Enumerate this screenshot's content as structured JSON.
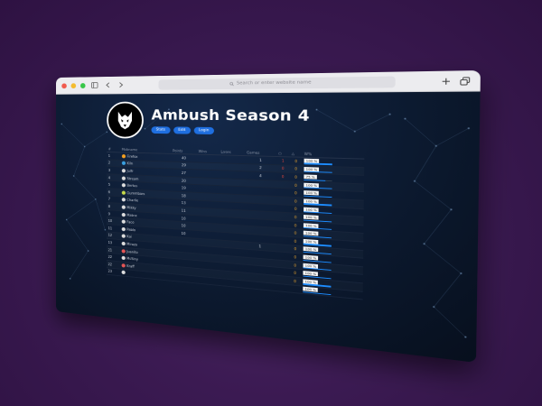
{
  "browser": {
    "address_placeholder": "Search or enter website name"
  },
  "page": {
    "title": "Ambush Season 4",
    "buttons": [
      "Stats",
      "Edit",
      "Login"
    ]
  },
  "table": {
    "headers": [
      "#",
      "Mobname",
      "Points",
      "Wins",
      "Loses",
      "Games",
      "○",
      "△",
      "W%"
    ],
    "rows": [
      {
        "rank": "1",
        "name": "Firefox",
        "points": "40",
        "wins": "",
        "loses": "",
        "games": "1",
        "c1": "1",
        "c2": "0",
        "pct": "100 %",
        "ratio": 1.0,
        "av": "#f5a020"
      },
      {
        "rank": "2",
        "name": "Kiln",
        "points": "29",
        "wins": "",
        "loses": "",
        "games": "2",
        "c1": "0",
        "c2": "0",
        "pct": "100 %",
        "ratio": 1.0,
        "av": "#3aa0e0"
      },
      {
        "rank": "3",
        "name": "Julfr",
        "points": "27",
        "wins": "",
        "loses": "",
        "games": "4",
        "c1": "0",
        "c2": "0",
        "pct": "75 %",
        "ratio": 0.75,
        "av": "#dddddd"
      },
      {
        "rank": "4",
        "name": "Stream",
        "points": "20",
        "wins": "",
        "loses": "",
        "games": "",
        "c1": "",
        "c2": "0",
        "pct": "100 %",
        "ratio": 1.0,
        "av": "#dddddd"
      },
      {
        "rank": "5",
        "name": "Bertus",
        "points": "19",
        "wins": "",
        "loses": "",
        "games": "",
        "c1": "",
        "c2": "0",
        "pct": "100 %",
        "ratio": 1.0,
        "av": "#dddddd"
      },
      {
        "rank": "6",
        "name": "Gummbars",
        "points": "18",
        "wins": "",
        "loses": "",
        "games": "",
        "c1": "",
        "c2": "0",
        "pct": "100 %",
        "ratio": 1.0,
        "av": "#c7d94a"
      },
      {
        "rank": "7",
        "name": "Charlie",
        "points": "13",
        "wins": "",
        "loses": "",
        "games": "",
        "c1": "",
        "c2": "0",
        "pct": "100 %",
        "ratio": 1.0,
        "av": "#dddddd"
      },
      {
        "rank": "8",
        "name": "Mikky",
        "points": "11",
        "wins": "",
        "loses": "",
        "games": "",
        "c1": "",
        "c2": "0",
        "pct": "100 %",
        "ratio": 1.0,
        "av": "#dddddd"
      },
      {
        "rank": "9",
        "name": "Matrıx",
        "points": "10",
        "wins": "",
        "loses": "",
        "games": "",
        "c1": "",
        "c2": "0",
        "pct": "100 %",
        "ratio": 1.0,
        "av": "#dddddd"
      },
      {
        "rank": "10",
        "name": "Faco",
        "points": "10",
        "wins": "",
        "loses": "",
        "games": "",
        "c1": "",
        "c2": "0",
        "pct": "100 %",
        "ratio": 1.0,
        "av": "#dddddd"
      },
      {
        "rank": "11",
        "name": "Pablo",
        "points": "10",
        "wins": "",
        "loses": "",
        "games": "",
        "c1": "",
        "c2": "0",
        "pct": "100 %",
        "ratio": 1.0,
        "av": "#dddddd"
      },
      {
        "rank": "12",
        "name": "Kai",
        "points": "",
        "wins": "",
        "loses": "",
        "games": "1",
        "c1": "",
        "c2": "0",
        "pct": "100 %",
        "ratio": 1.0,
        "av": "#dddddd"
      },
      {
        "rank": "13",
        "name": "Mirazo",
        "points": "",
        "wins": "",
        "loses": "",
        "games": "",
        "c1": "",
        "c2": "0",
        "pct": "100 %",
        "ratio": 1.0,
        "av": "#dddddd"
      },
      {
        "rank": "21",
        "name": "Juanito",
        "points": "",
        "wins": "",
        "loses": "",
        "games": "",
        "c1": "",
        "c2": "0",
        "pct": "100 %",
        "ratio": 1.0,
        "av": "#e25555"
      },
      {
        "rank": "22",
        "name": "McSiny",
        "points": "",
        "wins": "",
        "loses": "",
        "games": "",
        "c1": "",
        "c2": "0",
        "pct": "100 %",
        "ratio": 1.0,
        "av": "#dddddd"
      },
      {
        "rank": "22",
        "name": "Kraff",
        "points": "",
        "wins": "",
        "loses": "",
        "games": "",
        "c1": "",
        "c2": "0",
        "pct": "100 %",
        "ratio": 1.0,
        "av": "#e25555"
      },
      {
        "rank": "23",
        "name": "",
        "points": "",
        "wins": "",
        "loses": "",
        "games": "",
        "c1": "",
        "c2": "",
        "pct": "100 %",
        "ratio": 1.0,
        "av": "#dddddd"
      }
    ]
  },
  "colors": {
    "accent": "#1f6fe0",
    "loss": "#e0453b",
    "draw": "#e6a22e",
    "frame": "#3b1a52"
  }
}
